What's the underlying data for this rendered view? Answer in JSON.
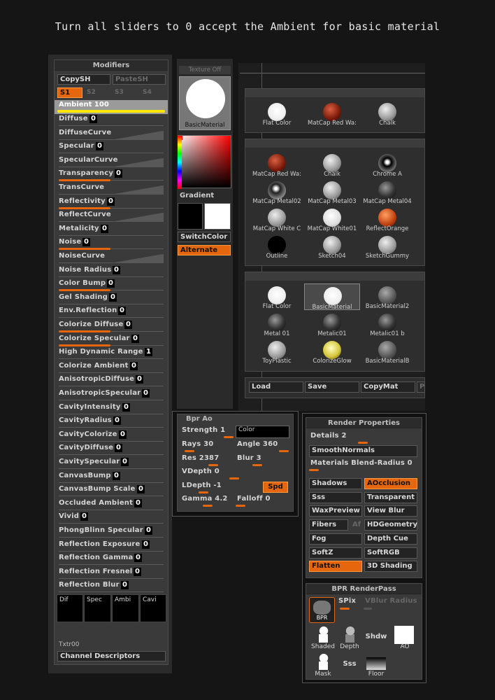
{
  "heading": "Turn all sliders to 0 accept the Ambient for basic material",
  "modifiers": {
    "title": "Modifiers",
    "copy_sh": "CopySH",
    "paste_sh": "PasteSH",
    "s_tabs": [
      "S1",
      "S2",
      "S3",
      "S4"
    ],
    "ambient": {
      "label": "Ambient",
      "value": "100",
      "fill": 1.0
    },
    "sliders": [
      {
        "label": "Diffuse",
        "value": "0",
        "curve": false
      },
      {
        "label": "DiffuseCurve",
        "value": "",
        "curve": true
      },
      {
        "label": "Specular",
        "value": "0",
        "curve": false
      },
      {
        "label": "SpecularCurve",
        "value": "",
        "curve": true
      },
      {
        "label": "Transparency",
        "value": "0",
        "curve": false,
        "marker": 0.5
      },
      {
        "label": "TransCurve",
        "value": "",
        "curve": true
      },
      {
        "label": "Reflectivity",
        "value": "0",
        "curve": false,
        "marker": 0.5
      },
      {
        "label": "ReflectCurve",
        "value": "",
        "curve": true
      },
      {
        "label": "Metalicity",
        "value": "0",
        "curve": false
      },
      {
        "label": "Noise",
        "value": "0",
        "curve": false,
        "marker": 0.5
      },
      {
        "label": "NoiseCurve",
        "value": "",
        "curve": true
      },
      {
        "label": "Noise Radius",
        "value": "0",
        "curve": false
      },
      {
        "label": "Color Bump",
        "value": "0",
        "curve": false,
        "marker": 0.5
      },
      {
        "label": "Gel Shading",
        "value": "0",
        "curve": false
      },
      {
        "label": "Env.Reflection",
        "value": "0",
        "curve": false
      },
      {
        "label": "Colorize Diffuse",
        "value": "0",
        "curve": false,
        "marker": 0.5
      },
      {
        "label": "Colorize Specular",
        "value": "0",
        "curve": false,
        "marker": 0.5
      },
      {
        "label": "High Dynamic Range",
        "value": "1",
        "curve": false
      },
      {
        "label": "Colorize Ambient",
        "value": "0",
        "curve": false
      },
      {
        "label": "AnisotropicDiffuse",
        "value": "0",
        "curve": false
      },
      {
        "label": "AnisotropicSpecular",
        "value": "0",
        "curve": false
      },
      {
        "label": "CavityIntensity",
        "value": "0",
        "curve": false
      },
      {
        "label": "CavityRadius",
        "value": "0",
        "curve": false
      },
      {
        "label": "CavityColorize",
        "value": "0",
        "curve": false
      },
      {
        "label": "CavityDiffuse",
        "value": "0",
        "curve": false
      },
      {
        "label": "CavitySpecular",
        "value": "0",
        "curve": false
      },
      {
        "label": "CanvasBump",
        "value": "0",
        "curve": false
      },
      {
        "label": "CanvasBump Scale",
        "value": "0",
        "curve": false
      },
      {
        "label": "Occluded Ambient",
        "value": "0",
        "curve": false
      },
      {
        "label": "Vivid",
        "value": "0",
        "curve": false
      },
      {
        "label": "PhongBlinn Specular",
        "value": "0",
        "curve": false
      },
      {
        "label": "Reflection Exposure",
        "value": "0",
        "curve": false
      },
      {
        "label": "Reflection Gamma",
        "value": "0",
        "curve": false
      },
      {
        "label": "Reflection Fresnel",
        "value": "0",
        "curve": false
      },
      {
        "label": "Reflection Blur",
        "value": "0",
        "curve": false
      }
    ],
    "channels": [
      "Dif",
      "Spec",
      "Ambi",
      "Cavi"
    ],
    "txtr": "Txtr00",
    "channel_descriptors": "Channel Descriptors"
  },
  "material_panel": {
    "texture_off": "Texture Off",
    "current_material": "BasicMaterial",
    "gradient": "Gradient",
    "switch_color": "SwitchColor",
    "alternate": "Alternate"
  },
  "quick_pick": [
    {
      "name": "Flat Color",
      "color": "white"
    },
    {
      "name": "MatCap Red Wa:",
      "color": "red"
    },
    {
      "name": "Chalk",
      "color": "gray"
    }
  ],
  "matcaps": [
    {
      "name": "MatCap Red Wa:",
      "color": "red"
    },
    {
      "name": "Chalk",
      "color": "gray"
    },
    {
      "name": "Chrome A",
      "color": "chrome"
    },
    {
      "name": "MatCap Metal02",
      "color": "metal"
    },
    {
      "name": "MatCap Metal03",
      "color": "gray"
    },
    {
      "name": "MatCap Metal04",
      "color": "dark"
    },
    {
      "name": "MatCap White C",
      "color": "gray"
    },
    {
      "name": "MatCap White01",
      "color": "white2"
    },
    {
      "name": "ReflectOrange",
      "color": "orange"
    },
    {
      "name": "Outline",
      "color": "outline"
    },
    {
      "name": "Sketch04",
      "color": "gray"
    },
    {
      "name": "SketchGummy",
      "color": "gray"
    }
  ],
  "standard": [
    {
      "name": "Flat Color",
      "color": "white"
    },
    {
      "name": "BasicMaterial",
      "color": "white"
    },
    {
      "name": "BasicMaterial2",
      "color": "gray2"
    },
    {
      "name": "Metal 01",
      "color": "dark"
    },
    {
      "name": "Metalic01",
      "color": "dark"
    },
    {
      "name": "Metalic01 b",
      "color": "dark"
    },
    {
      "name": "ToyPlastic",
      "color": "gray"
    },
    {
      "name": "ColorizeGlow",
      "color": "yellow"
    },
    {
      "name": "BasicMaterialB",
      "color": "gray2"
    }
  ],
  "mat_buttons": {
    "load": "Load",
    "save": "Save",
    "copymat": "CopyMat",
    "paste": "P"
  },
  "bpr_ao": {
    "title": "Bpr Ao",
    "strength": "Strength 1",
    "color": "Color",
    "rays": "Rays 30",
    "angle": "Angle 360",
    "res": "Res 2387",
    "blur": "Blur 3",
    "vdepth": "VDepth 0",
    "ldepth": "LDepth -1",
    "spd": "Spd",
    "gamma": "Gamma 4.2",
    "falloff": "Falloff 0"
  },
  "render_props": {
    "title": "Render Properties",
    "details": "Details 2",
    "smooth_normals": "SmoothNormals",
    "materials_blend": "Materials Blend-Radius 0",
    "buttons": [
      [
        "Shadows",
        "AOcclusion"
      ],
      [
        "Sss",
        "Transparent"
      ],
      [
        "WaxPreview",
        "View Blur"
      ],
      [
        "Fibers",
        "HDGeometry"
      ],
      [
        "Fog",
        "Depth Cue"
      ],
      [
        "SoftZ",
        "SoftRGB"
      ],
      [
        "Flatten",
        "3D Shading"
      ]
    ],
    "fibers_af": "Af"
  },
  "renderpass": {
    "title": "BPR RenderPass",
    "bpr": "BPR",
    "spix": "SPix",
    "vblur": "VBlur Radius",
    "passes": [
      "Shaded",
      "Depth",
      "Shdw",
      "AO",
      "Mask",
      "Sss",
      "Floor"
    ]
  }
}
